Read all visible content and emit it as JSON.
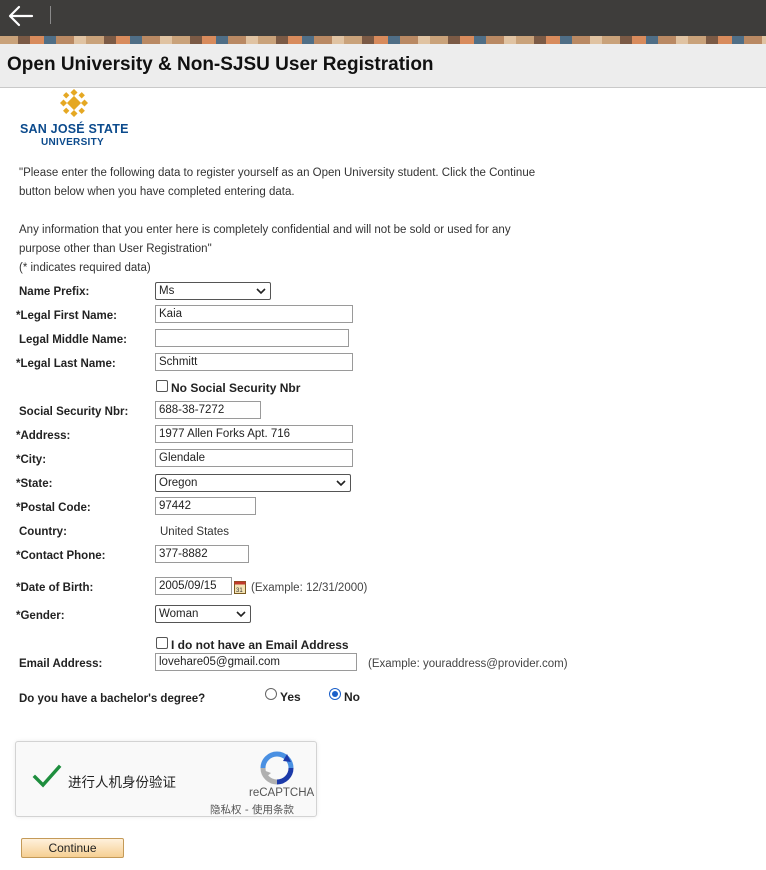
{
  "header": {
    "title": "Open University & Non-SJSU User Registration"
  },
  "logo": {
    "line1": "SAN JOSÉ STATE",
    "line2": "UNIVERSITY",
    "color": "#0b4a8c"
  },
  "intro": {
    "line1": "\"Please enter the following data to register yourself as an Open University student. Click the Continue",
    "line2": "button below when you have completed entering data.",
    "line3": "Any information that you enter here is completely confidential and will not be sold or used for any",
    "line4": "purpose other than User Registration\"",
    "line5": "(* indicates required data)"
  },
  "form": {
    "name_prefix": {
      "label": "Name Prefix:",
      "value": "Ms"
    },
    "first_name": {
      "label": "*Legal First Name:",
      "value": "Kaia"
    },
    "middle_name": {
      "label": "Legal Middle Name:",
      "value": ""
    },
    "last_name": {
      "label": "*Legal Last Name:",
      "value": "Schmitt"
    },
    "no_ssn": {
      "label": "No Social Security Nbr",
      "checked": false
    },
    "ssn": {
      "label": "Social Security Nbr:",
      "value": "688-38-7272"
    },
    "address": {
      "label": "*Address:",
      "value": "1977 Allen Forks Apt. 716"
    },
    "city": {
      "label": "*City:",
      "value": "Glendale"
    },
    "state": {
      "label": "*State:",
      "value": "Oregon"
    },
    "postal": {
      "label": "*Postal Code:",
      "value": "97442"
    },
    "country": {
      "label": "Country:",
      "value": "United States"
    },
    "phone": {
      "label": "*Contact Phone:",
      "value": "377-8882"
    },
    "dob": {
      "label": "*Date of Birth:",
      "value": "2005/09/15",
      "hint": "(Example: 12/31/2000)"
    },
    "gender": {
      "label": "*Gender:",
      "value": "Woman"
    },
    "no_email": {
      "label": "I do not have an Email Address",
      "checked": false
    },
    "email": {
      "label": "Email Address:",
      "value": "lovehare05@gmail.com",
      "hint": "(Example: youraddress@provider.com)"
    },
    "bachelor": {
      "label": "Do you have a bachelor's degree?",
      "yes": "Yes",
      "no": "No",
      "selected": "No"
    }
  },
  "captcha": {
    "text": "进行人机身份验证",
    "brand": "reCAPTCHA",
    "links": "隐私权 - 使用条款",
    "check_color": "#1e8e3e"
  },
  "buttons": {
    "continue": "Continue"
  }
}
